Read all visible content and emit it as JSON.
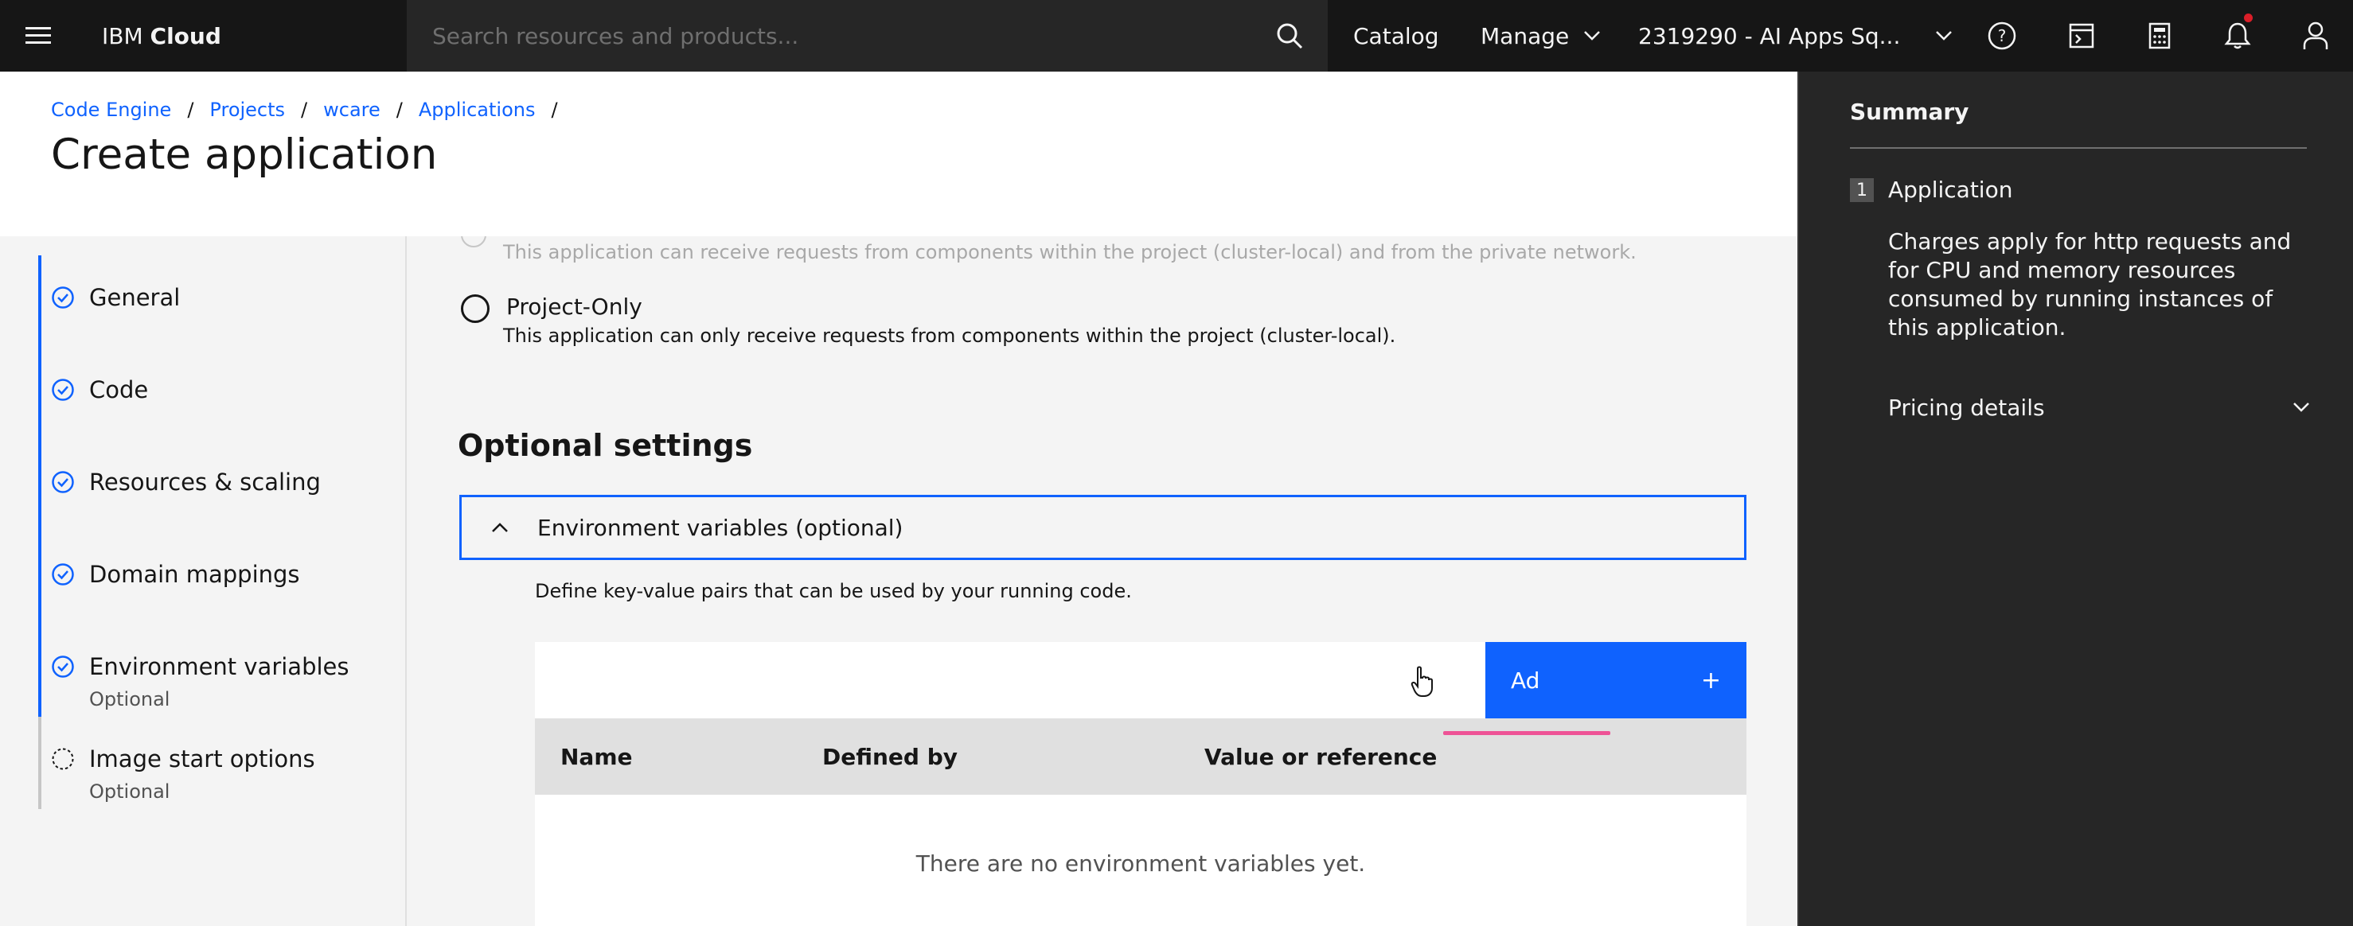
{
  "header": {
    "brand_prefix": "IBM",
    "brand_name": "Cloud",
    "search_placeholder": "Search resources and products...",
    "catalog_label": "Catalog",
    "manage_label": "Manage",
    "account_label": "2319290 - AI Apps Sq...",
    "notification_badge_color": "#da1e28"
  },
  "breadcrumb": {
    "items": [
      "Code Engine",
      "Projects",
      "wcare",
      "Applications"
    ],
    "separator": "/"
  },
  "page_title": "Create application",
  "progress_steps": [
    {
      "label": "General",
      "sub": "",
      "state": "complete"
    },
    {
      "label": "Code",
      "sub": "",
      "state": "complete"
    },
    {
      "label": "Resources & scaling",
      "sub": "",
      "state": "complete"
    },
    {
      "label": "Domain mappings",
      "sub": "",
      "state": "complete"
    },
    {
      "label": "Environment variables",
      "sub": "Optional",
      "state": "complete"
    },
    {
      "label": "Image start options",
      "sub": "Optional",
      "state": "incomplete"
    }
  ],
  "endpoint": {
    "faded_helper": "This application can receive requests from components within the project (cluster-local) and from the private network.",
    "project_only_label": "Project-Only",
    "project_only_helper": "This application can only receive requests from components within the project (cluster-local)."
  },
  "optional_settings": {
    "title": "Optional settings",
    "accordion_title": "Environment variables (optional)",
    "accordion_desc": "Define key-value pairs that can be used by your running code.",
    "add_button_label": "Ad",
    "add_button_icon": "+",
    "table_headers": [
      "Name",
      "Defined by",
      "Value or reference"
    ],
    "empty_message": "There are no environment variables yet."
  },
  "summary": {
    "title": "Summary",
    "step_number": "1",
    "step_label": "Application",
    "description": "Charges apply for http requests and for CPU and memory resources consumed by running instances of this application.",
    "pricing_label": "Pricing details"
  },
  "colors": {
    "accent": "#0f62fe",
    "header_bg": "#161616",
    "summary_bg": "#262626"
  }
}
